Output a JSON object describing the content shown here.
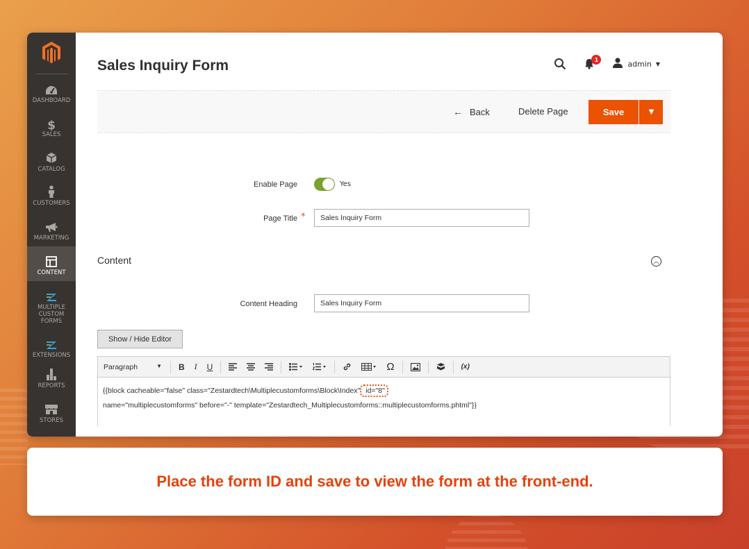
{
  "sidebar": {
    "items": [
      {
        "label": "DASHBOARD",
        "icon": "dashboard-icon"
      },
      {
        "label": "SALES",
        "icon": "dollar-icon"
      },
      {
        "label": "CATALOG",
        "icon": "box-icon"
      },
      {
        "label": "CUSTOMERS",
        "icon": "person-icon"
      },
      {
        "label": "MARKETING",
        "icon": "megaphone-icon"
      },
      {
        "label": "CONTENT",
        "icon": "layout-icon"
      },
      {
        "label": "MULTIPLE CUSTOM FORMS",
        "icon": "z-logo-icon"
      },
      {
        "label": "EXTENSIONS",
        "icon": "z-logo-icon"
      },
      {
        "label": "REPORTS",
        "icon": "bar-chart-icon"
      },
      {
        "label": "STORES",
        "icon": "store-icon"
      }
    ],
    "active": "CONTENT"
  },
  "header": {
    "title": "Sales Inquiry Form",
    "notification_count": "1",
    "user": "admin"
  },
  "toolbar": {
    "back_label": "Back",
    "delete_label": "Delete Page",
    "save_label": "Save"
  },
  "form": {
    "enable_page_label": "Enable Page",
    "enable_page_value": "Yes",
    "page_title_label": "Page Title",
    "page_title_value": "Sales Inquiry Form",
    "content_section": "Content",
    "content_heading_label": "Content Heading",
    "content_heading_value": "Sales Inquiry Form",
    "show_hide_label": "Show / Hide Editor"
  },
  "editor": {
    "format": "Paragraph",
    "line1_pre": "{{block cacheable=\"false\" class=\"Zestardtech\\Multiplecustomforms\\Block\\Index\"",
    "line1_hl": " id=\"8\"",
    "line2": " name=\"multiplecustomforms\" before=\"-\" template=\"Zestardtech_Multiplecustomforms::multiplecustomforms.phtml\"}}"
  },
  "caption": "Place the form ID and save to view the form at the front-end.",
  "colors": {
    "accent": "#eb5202",
    "sidebar": "#373330",
    "toggle_on": "#79a22e",
    "caption": "#e8400c"
  }
}
